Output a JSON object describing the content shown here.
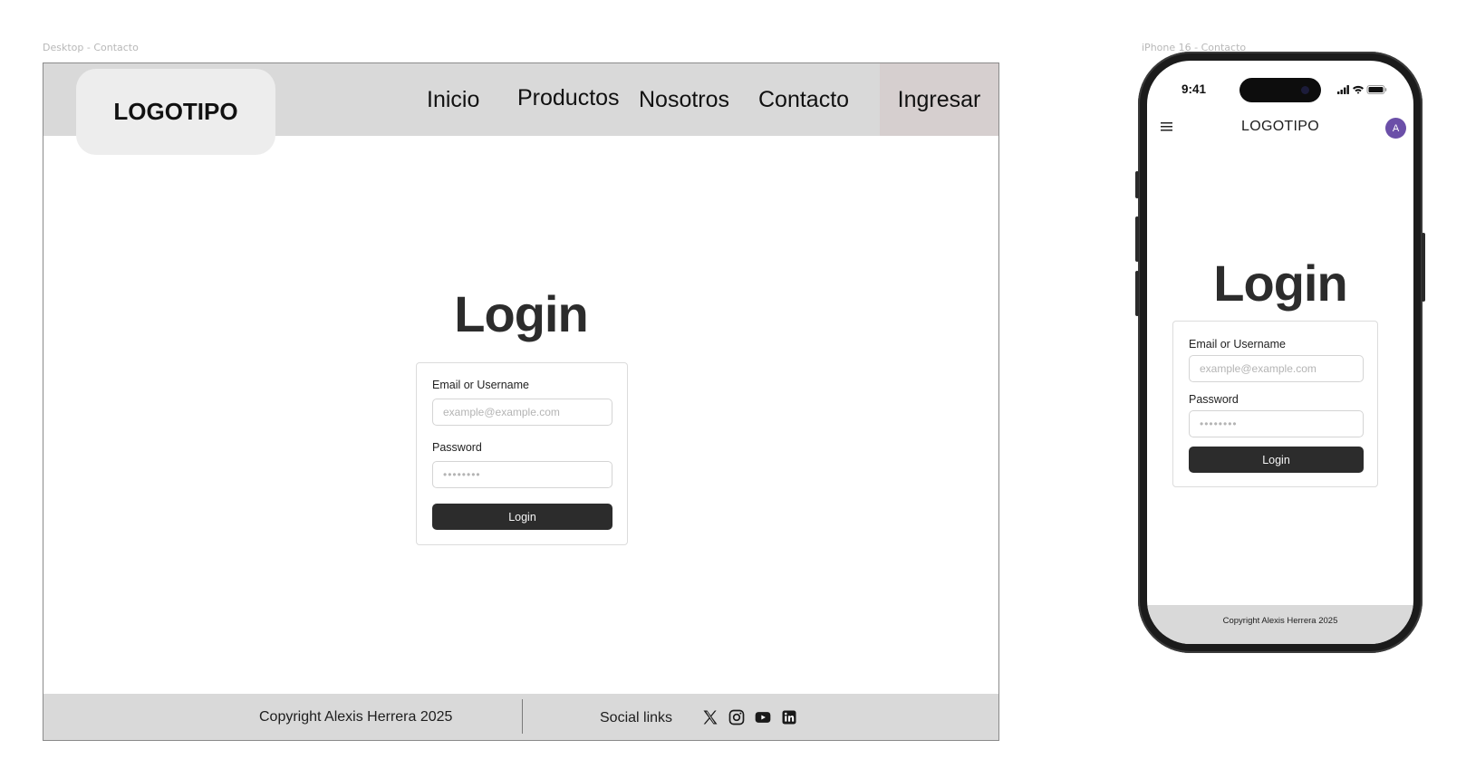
{
  "desktop": {
    "frame_label": "Desktop - Contacto",
    "header": {
      "logo": "LOGOTIPO",
      "nav": [
        {
          "label": "Inicio"
        },
        {
          "label": "Productos"
        },
        {
          "label": "Nosotros"
        },
        {
          "label": "Contacto"
        }
      ],
      "cta": "Ingresar"
    },
    "title": "Login",
    "form": {
      "email_label": "Email or Username",
      "email_placeholder": "example@example.com",
      "password_label": "Password",
      "password_value": "••••••••",
      "submit": "Login"
    },
    "footer": {
      "copyright": "Copyright Alexis Herrera 2025",
      "social_label": "Social links",
      "social_icons": [
        "x-icon",
        "instagram-icon",
        "youtube-icon",
        "linkedin-icon"
      ]
    }
  },
  "mobile": {
    "frame_label": "iPhone 16 - Contacto",
    "status_time": "9:41",
    "header": {
      "logo": "LOGOTIPO",
      "avatar_initial": "A"
    },
    "title": "Login",
    "form": {
      "email_label": "Email or Username",
      "email_placeholder": "example@example.com",
      "password_label": "Password",
      "password_value": "••••••••",
      "submit": "Login"
    },
    "footer": {
      "copyright": "Copyright Alexis Herrera 2025"
    }
  },
  "colors": {
    "header_bg": "#d9d9d9",
    "cta_bg": "#d6cfcf",
    "button_bg": "#2c2c2c",
    "avatar_bg": "#6b4fa8"
  }
}
